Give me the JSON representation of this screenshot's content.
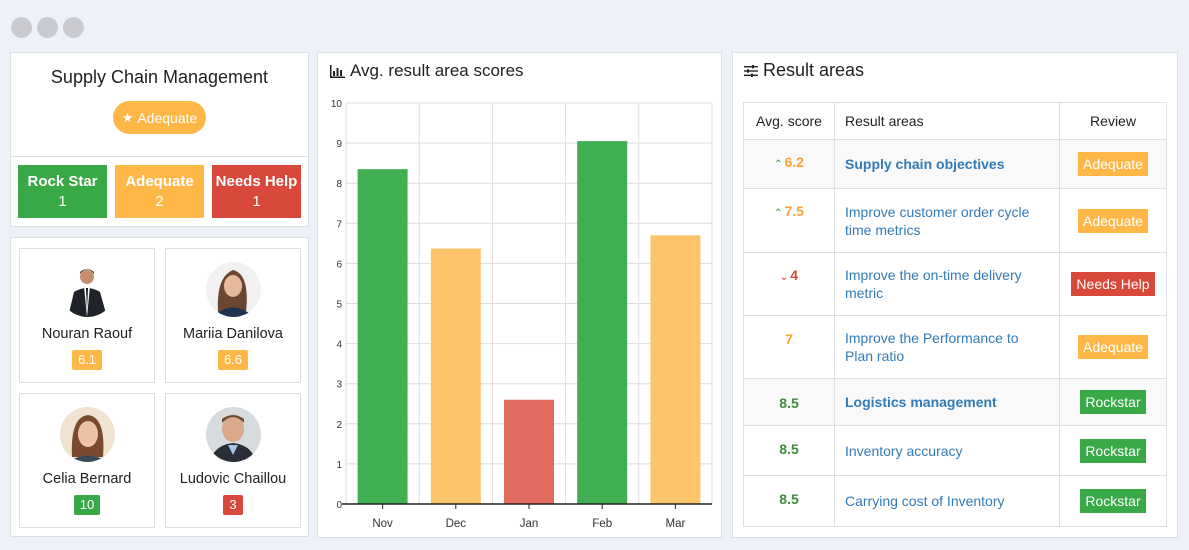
{
  "window": {
    "controls": [
      "close",
      "minimize",
      "maximize"
    ]
  },
  "summary": {
    "title": "Supply Chain Management",
    "status": {
      "label": "Adequate",
      "icon": "star-icon",
      "color": "#ffb748"
    },
    "counts": [
      {
        "label": "Rock Star",
        "value": "1",
        "color": "#39a947"
      },
      {
        "label": "Adequate",
        "value": "2",
        "color": "#ffb748"
      },
      {
        "label": "Needs Help",
        "value": "1",
        "color": "#d9493b"
      }
    ]
  },
  "people": [
    {
      "name": "Nouran Raouf",
      "score": "6.1",
      "color": "#ffb748"
    },
    {
      "name": "Mariia Danilova",
      "score": "6.6",
      "color": "#ffb748"
    },
    {
      "name": "Celia Bernard",
      "score": "10",
      "color": "#39a947"
    },
    {
      "name": "Ludovic Chaillou",
      "score": "3",
      "color": "#d9493b"
    }
  ],
  "chart_panel": {
    "title": "Avg. result area scores",
    "icon": "bar-chart-icon"
  },
  "chart_data": {
    "type": "bar",
    "title": "Avg. result area scores",
    "categories": [
      "Nov",
      "Dec",
      "Jan",
      "Feb",
      "Mar"
    ],
    "values": [
      8.35,
      6.37,
      2.6,
      9.05,
      6.7
    ],
    "colors": [
      "#3faf52",
      "#fdc469",
      "#e06b5e",
      "#3faf52",
      "#fdc469"
    ],
    "xlabel": "",
    "ylabel": "",
    "ylim": [
      0,
      10
    ],
    "yticks": [
      "0",
      "1",
      "2",
      "3",
      "4",
      "5",
      "6",
      "7",
      "8",
      "9",
      "10"
    ],
    "grid": true,
    "legend": "none"
  },
  "areas_panel": {
    "title": "Result areas",
    "icon": "sliders-icon",
    "headers": [
      "Avg. score",
      "Result areas",
      "Review"
    ],
    "rows": [
      {
        "score": "6.2",
        "trend": "up",
        "score_color": "amber",
        "area": "Supply chain objectives",
        "group": true,
        "review": "Adequate",
        "review_color": "#ffb748"
      },
      {
        "score": "7.5",
        "trend": "up",
        "score_color": "amber",
        "area": "Improve customer order cycle time metrics",
        "group": false,
        "review": "Adequate",
        "review_color": "#ffb748"
      },
      {
        "score": "4",
        "trend": "down",
        "score_color": "red",
        "area": "Improve the on-time delivery metric",
        "group": false,
        "review": "Needs Help",
        "review_color": "#d9493b"
      },
      {
        "score": "7",
        "trend": "",
        "score_color": "amber",
        "area": "Improve the Performance to Plan ratio",
        "group": false,
        "review": "Adequate",
        "review_color": "#ffb748"
      },
      {
        "score": "8.5",
        "trend": "",
        "score_color": "green",
        "area": "Logistics management",
        "group": true,
        "review": "Rockstar",
        "review_color": "#39a947"
      },
      {
        "score": "8.5",
        "trend": "",
        "score_color": "green",
        "area": "Inventory accuracy",
        "group": false,
        "review": "Rockstar",
        "review_color": "#39a947"
      },
      {
        "score": "8.5",
        "trend": "",
        "score_color": "green",
        "area": "Carrying cost of Inventory",
        "group": false,
        "review": "Rockstar",
        "review_color": "#39a947"
      }
    ]
  }
}
